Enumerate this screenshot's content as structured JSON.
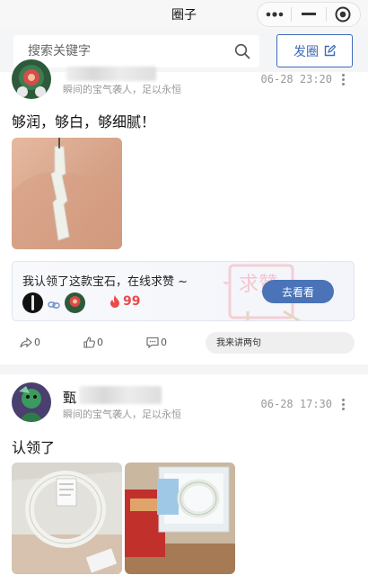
{
  "navbar": {
    "title": "圈子",
    "capsule": {
      "menu_icon": "more-dots-icon",
      "minimize_icon": "minimize-icon",
      "close_icon": "target-icon"
    }
  },
  "search": {
    "placeholder": "搜索关键字",
    "icon": "search-icon",
    "post_button_label": "发圈",
    "post_button_icon": "edit-icon",
    "accent_color": "#3f6ab8"
  },
  "posts": [
    {
      "user_name": "",
      "motto": "瞬间的宝气袭人，足以永恒",
      "time": "06-28 23:20",
      "text": "够润，够白，够细腻！",
      "claim": {
        "text": "我认领了这款宝石，在线求赞 ~",
        "count": "99",
        "button_label": "去看看",
        "watermark": "求赞"
      },
      "actions": {
        "share_count": "0",
        "like_count": "0",
        "comment_count": "0"
      },
      "comment_placeholder": "我来讲两句"
    },
    {
      "user_name": "甄",
      "motto": "瞬间的宝气袭人，足以永恒",
      "time": "06-28 17:30",
      "text": "认领了"
    }
  ]
}
